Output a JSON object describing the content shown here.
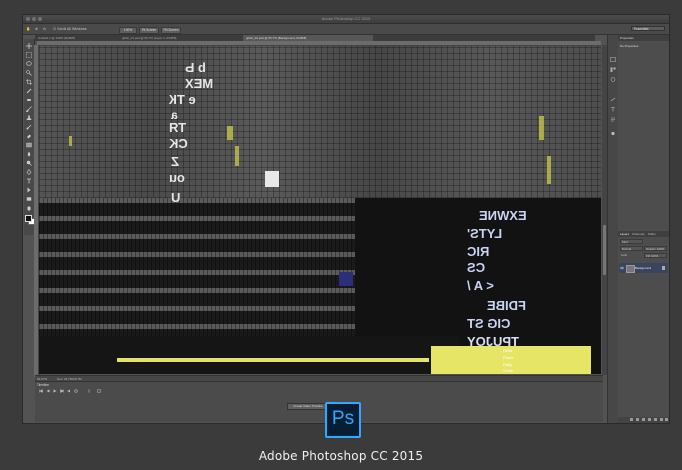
{
  "window": {
    "title": "Adobe Photoshop CC 2015"
  },
  "options_bar": {
    "scroll_all_windows": "Scroll All Windows",
    "zoom_pct": "100%",
    "fit_screen": "Fit Screen",
    "fill_screen": "Fill Screen",
    "workspace": "Essentials"
  },
  "tabs": [
    {
      "label": "Untitled-1 @ 100% (RGB/8)",
      "active": false
    },
    {
      "label": "glitch_01.psd @ 66.7% (Layer 1, RGB/8)",
      "active": false
    },
    {
      "label": "glitch_02.psd @ 66.7% (Background, RGB/8)",
      "active": true
    }
  ],
  "canvas_text": {
    "upper": [
      "b Ь",
      "MEX",
      "e ТК",
      "a",
      "ТЯ",
      "CK",
      "Z",
      "ou",
      "U"
    ],
    "right": [
      "EXWNE",
      "LYTS'",
      "RIC",
      "CS",
      "<   A /",
      "FDIBE",
      "CIG ST",
      "TPUJOY"
    ],
    "yellow": [
      "Rella",
      "Pame",
      "Rally",
      "Smile"
    ]
  },
  "status": {
    "zoom": "66.67%",
    "doc": "Doc: 18.7M/18.7M"
  },
  "timeline": {
    "tab": "Timeline",
    "create_button": "Create Video Timeline"
  },
  "properties": {
    "title": "Properties",
    "empty": "No Properties"
  },
  "layers": {
    "tabs": [
      "Layers",
      "Channels",
      "Paths"
    ],
    "kind": "Kind",
    "blend_mode": "Normal",
    "opacity": "Opacity: 100%",
    "lock": "Lock:",
    "fill": "Fill: 100%",
    "layer_name": "Background"
  },
  "footer": {
    "logo_text": "Ps",
    "caption": "Adobe Photoshop CC 2015"
  },
  "colors": {
    "accent": "#31a8ff",
    "logo_bg": "#061e33",
    "yellow": "#e6e565"
  }
}
